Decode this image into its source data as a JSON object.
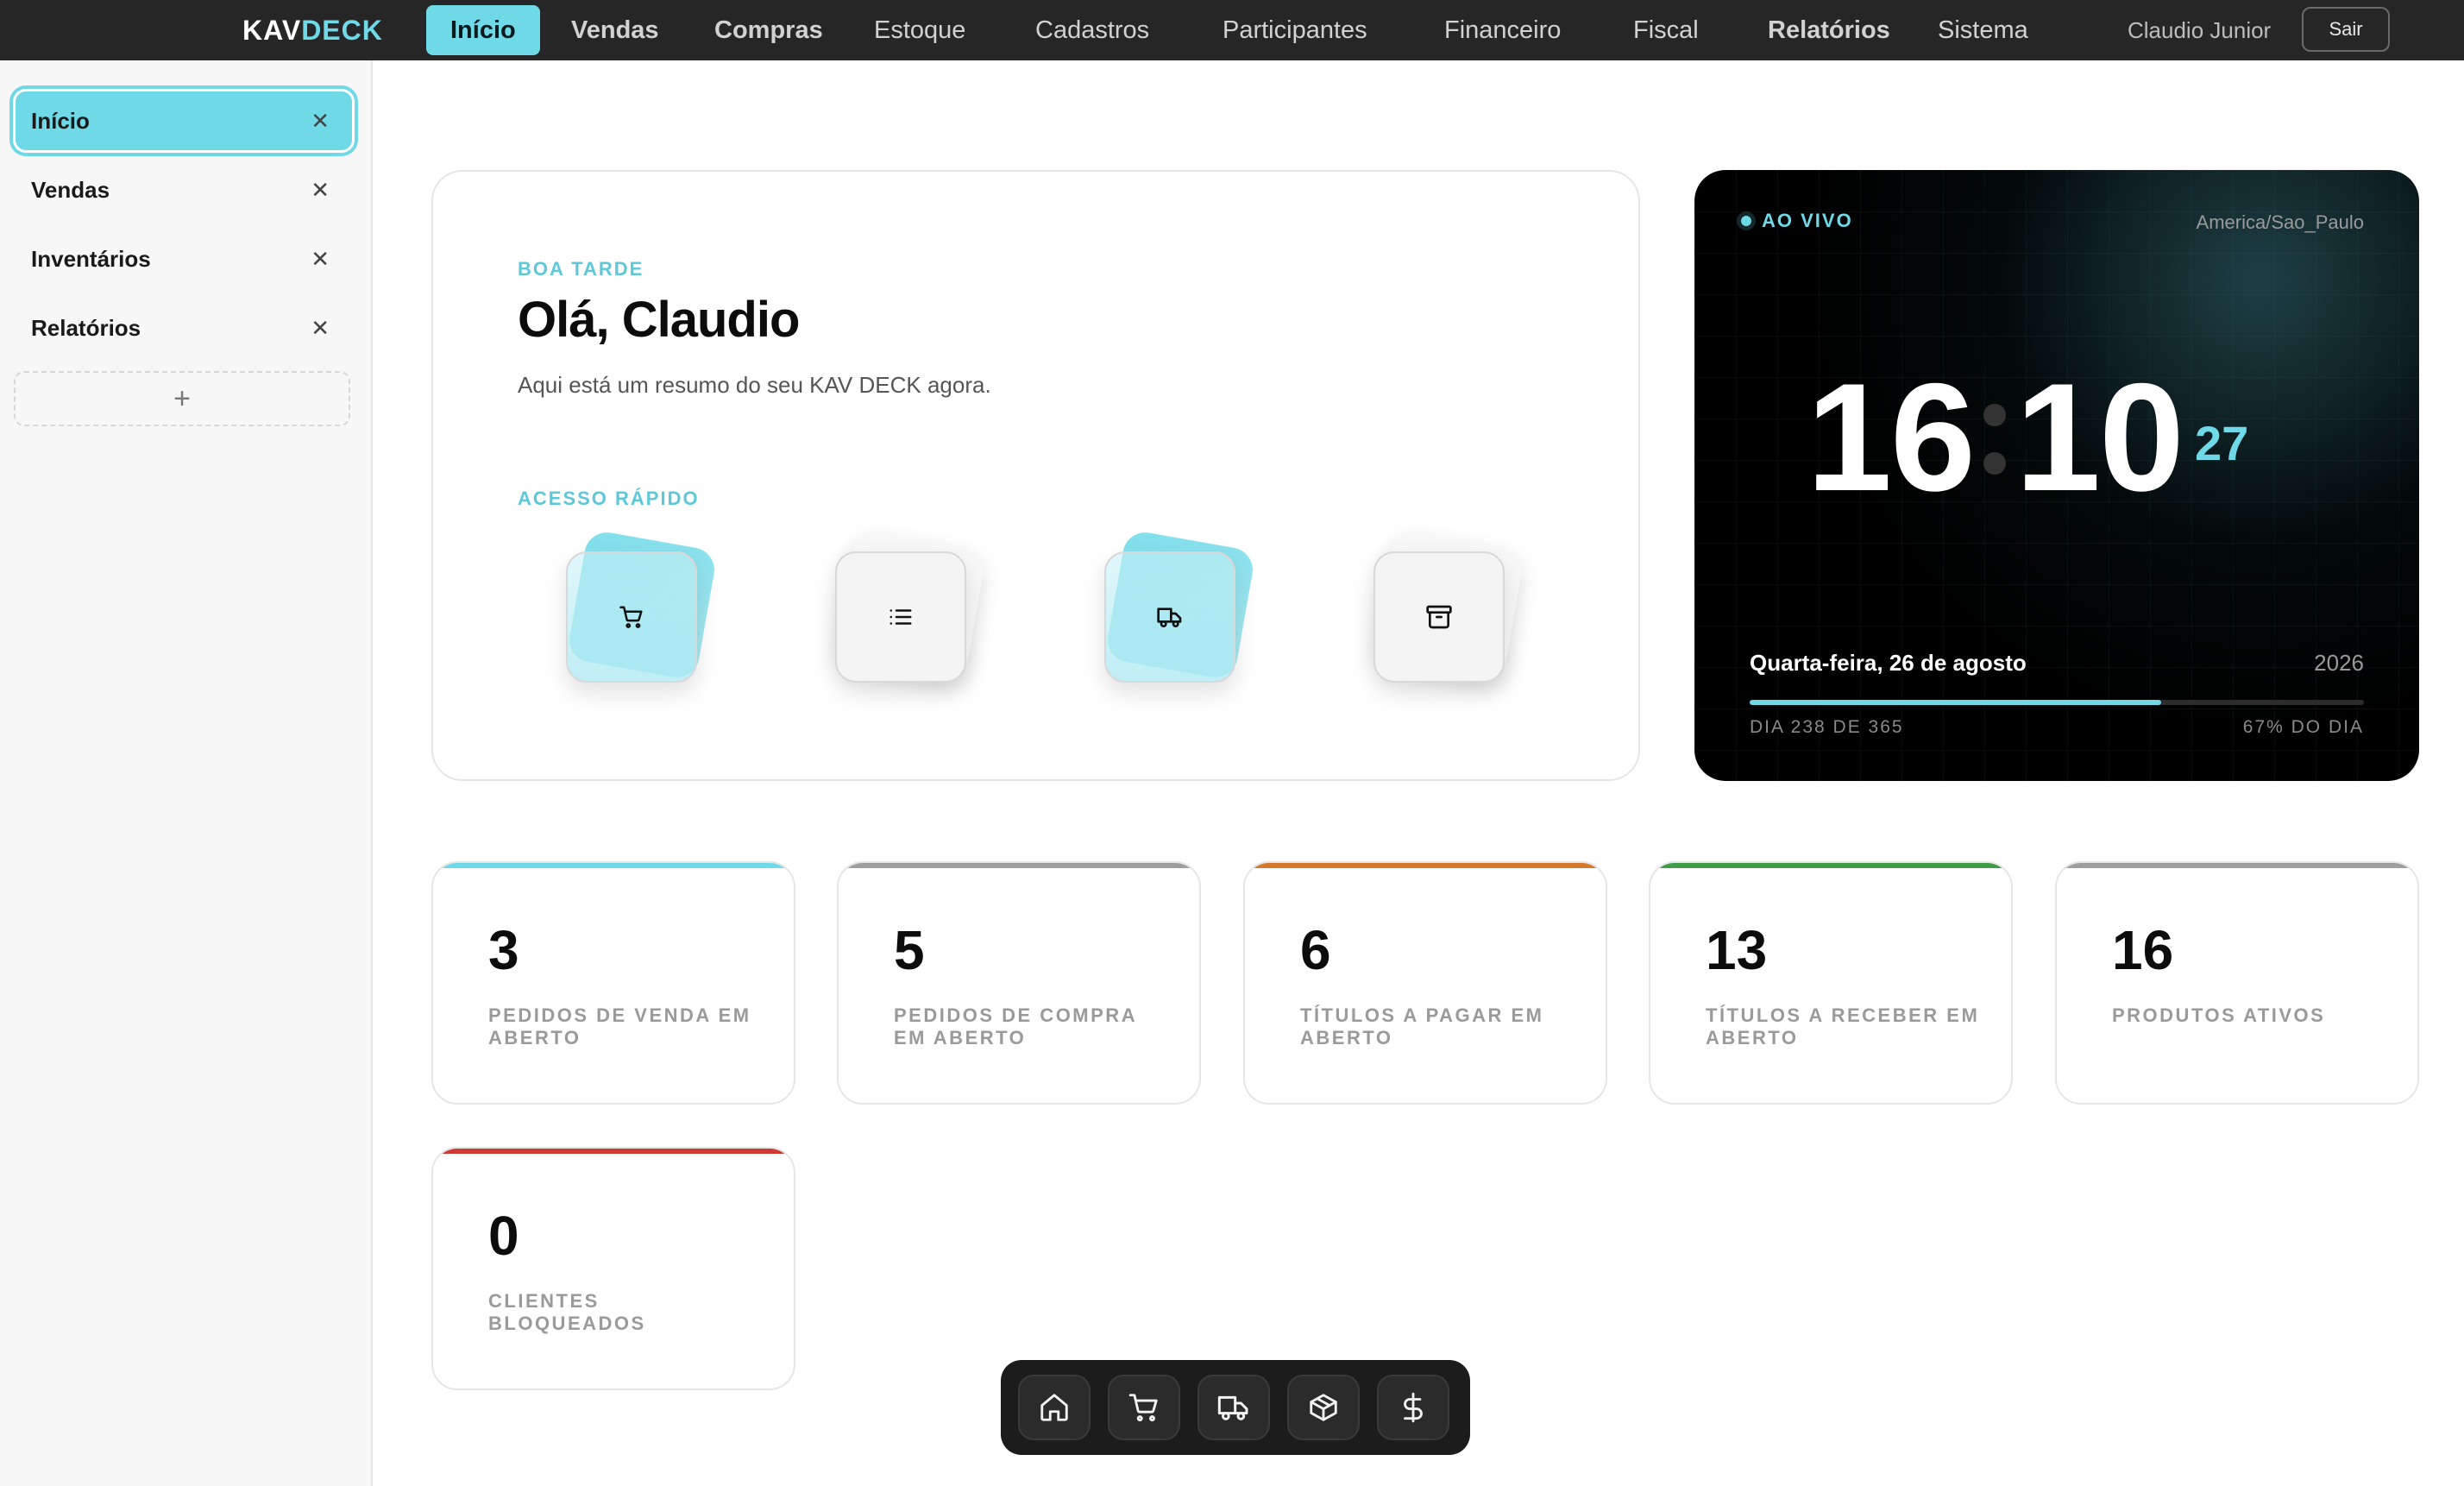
{
  "app": {
    "logo_part1": "KAV",
    "logo_part2": "DECK"
  },
  "nav": {
    "items": [
      {
        "label": "Início",
        "active": true
      },
      {
        "label": "Vendas",
        "bold": true
      },
      {
        "label": "Compras",
        "bold": true
      },
      {
        "label": "Estoque"
      },
      {
        "label": "Cadastros"
      },
      {
        "label": "Participantes"
      },
      {
        "label": "Financeiro"
      },
      {
        "label": "Fiscal"
      },
      {
        "label": "Relatórios",
        "bold": true
      },
      {
        "label": "Sistema"
      }
    ],
    "user_name": "Claudio Junior",
    "logout_label": "Sair"
  },
  "sidebar": {
    "tabs": [
      {
        "label": "Início",
        "active": true
      },
      {
        "label": "Vendas"
      },
      {
        "label": "Inventários"
      },
      {
        "label": "Relatórios"
      }
    ],
    "close_symbol": "✕",
    "add_symbol": "+"
  },
  "welcome": {
    "greeting_label": "BOA TARDE",
    "hello": "Olá, Claudio",
    "subtitle": "Aqui está um resumo do seu KAV DECK agora.",
    "quick_access_label": "ACESSO RÁPIDO",
    "quick_access": [
      {
        "icon": "cart-icon",
        "style": "cyan"
      },
      {
        "icon": "list-icon",
        "style": "light"
      },
      {
        "icon": "truck-icon",
        "style": "cyan"
      },
      {
        "icon": "archive-icon",
        "style": "light"
      }
    ]
  },
  "clock": {
    "live_label": "AO VIVO",
    "timezone": "America/Sao_Paulo",
    "hours": "16",
    "minutes": "10",
    "seconds": "27",
    "date": "Quarta-feira, 26 de agosto",
    "year": "2026",
    "day_of_year": "DIA 238 DE 365",
    "day_progress_label": "67% DO DIA",
    "day_progress": 0.67,
    "accent_color": "#6fd9e8"
  },
  "stats": [
    {
      "value": "3",
      "label": "PEDIDOS DE VENDA EM ABERTO",
      "color": "#6fd9e8"
    },
    {
      "value": "5",
      "label": "PEDIDOS DE COMPRA EM ABERTO",
      "color": "#9e9e9e"
    },
    {
      "value": "6",
      "label": "TÍTULOS A PAGAR EM ABERTO",
      "color": "#d6782a"
    },
    {
      "value": "13",
      "label": "TÍTULOS A RECEBER EM ABERTO",
      "color": "#3e9e47"
    },
    {
      "value": "16",
      "label": "PRODUTOS ATIVOS",
      "color": "#9e9e9e"
    },
    {
      "value": "0",
      "label": "CLIENTES BLOQUEADOS",
      "color": "#d03a34"
    }
  ],
  "dock": {
    "items": [
      {
        "icon": "home-icon"
      },
      {
        "icon": "cart-icon"
      },
      {
        "icon": "truck-icon"
      },
      {
        "icon": "box-icon"
      },
      {
        "icon": "dollar-icon"
      }
    ]
  }
}
